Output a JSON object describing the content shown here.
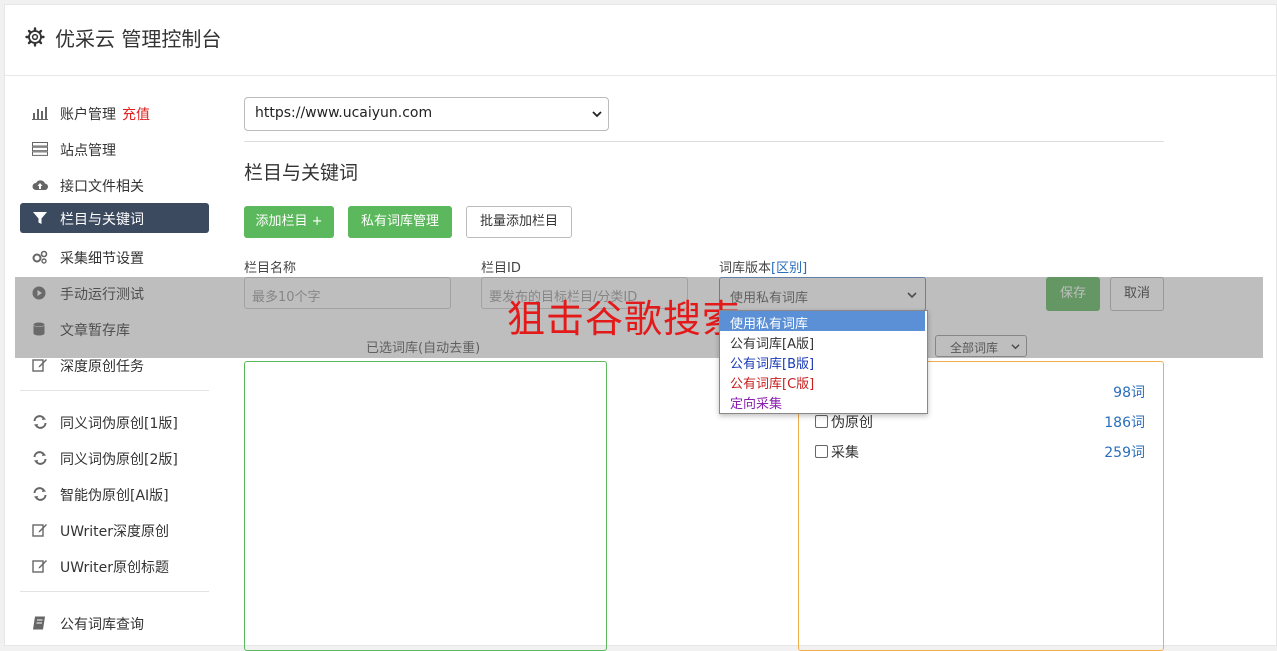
{
  "app": {
    "title": "优采云 管理控制台"
  },
  "sidebar": {
    "account": {
      "label": "账户管理",
      "recharge": "充值"
    },
    "items": [
      {
        "label": "站点管理"
      },
      {
        "label": "接口文件相关"
      },
      {
        "label": "栏目与关键词"
      },
      {
        "label": "采集细节设置"
      },
      {
        "label": "手动运行测试"
      },
      {
        "label": "文章暂存库"
      },
      {
        "label": "深度原创任务"
      },
      {
        "label": "同义词伪原创[1版]"
      },
      {
        "label": "同义词伪原创[2版]"
      },
      {
        "label": "智能伪原创[AI版]"
      },
      {
        "label": "UWriter深度原创"
      },
      {
        "label": "UWriter原创标题"
      },
      {
        "label": "公有词库查询"
      }
    ],
    "active_index": 2
  },
  "main": {
    "site_select": "https://www.ucaiyun.com",
    "section_title": "栏目与关键词",
    "buttons": {
      "add_column": "添加栏目 +",
      "private_lib": "私有词库管理",
      "batch_add": "批量添加栏目"
    },
    "form": {
      "col_name_label": "栏目名称",
      "col_name_placeholder": "最多10个字",
      "col_id_label": "栏目ID",
      "col_id_placeholder": "要发布的目标栏目/分类ID",
      "lib_version_label": "词库版本",
      "lib_version_link": "[区别]",
      "lib_version_value": "使用私有词库",
      "save": "保存",
      "cancel": "取消"
    },
    "selected_caption": "已选词库(自动去重)",
    "lib_filter": "全部词库",
    "libraries": [
      {
        "name": "",
        "count": "98词"
      },
      {
        "name": "伪原创",
        "count": "186词"
      },
      {
        "name": "采集",
        "count": "259词"
      }
    ]
  },
  "dropdown": {
    "options": [
      {
        "label": "使用私有词库",
        "color": "#ffffff"
      },
      {
        "label": "公有词库[A版]",
        "color": "#333333"
      },
      {
        "label": "公有词库[B版]",
        "color": "#1a3bb5"
      },
      {
        "label": "公有词库[C版]",
        "color": "#c81e1e"
      },
      {
        "label": "定向采集",
        "color": "#8a1fb0"
      }
    ],
    "selected_index": 0
  },
  "watermark": "狙击谷歌搜索",
  "colors": {
    "accent_green": "#5cb85c",
    "sidebar_active": "#3c4a60",
    "link_blue": "#2a6ebb",
    "recharge_red": "#e02020",
    "watermark_red": "#e41a1a"
  }
}
